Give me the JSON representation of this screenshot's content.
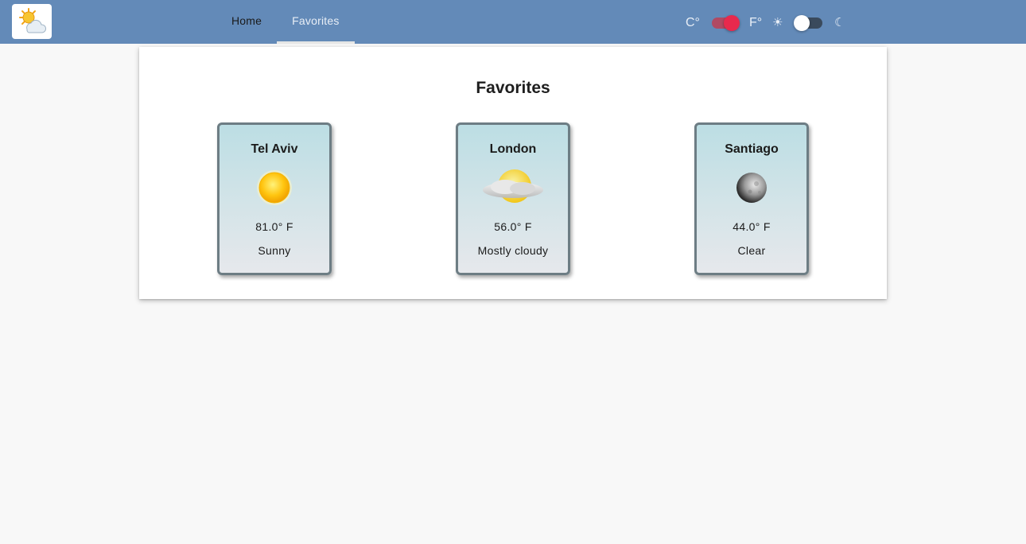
{
  "header": {
    "logo_icon": "sun-cloud-logo-icon",
    "nav": [
      {
        "label": "Home",
        "selected": false
      },
      {
        "label": "Favorites",
        "selected": true
      }
    ],
    "unit_toggle": {
      "left_label": "C°",
      "right_label": "F°",
      "state": "F",
      "track_color": "#b04a63",
      "thumb_color": "#e8294d"
    },
    "theme_toggle": {
      "light_icon": "☀",
      "dark_icon": "☾",
      "state": "light",
      "track_color": "#3a4a5c",
      "thumb_color": "#ffffff"
    },
    "bar_color": "#638ab8"
  },
  "main": {
    "title": "Favorites",
    "favorites": [
      {
        "city": "Tel Aviv",
        "icon": "sun-icon",
        "temperature": "81.0° F",
        "description": "Sunny"
      },
      {
        "city": "London",
        "icon": "cloudy-icon",
        "temperature": "56.0° F",
        "description": "Mostly cloudy"
      },
      {
        "city": "Santiago",
        "icon": "moon-icon",
        "temperature": "44.0° F",
        "description": "Clear"
      }
    ]
  }
}
